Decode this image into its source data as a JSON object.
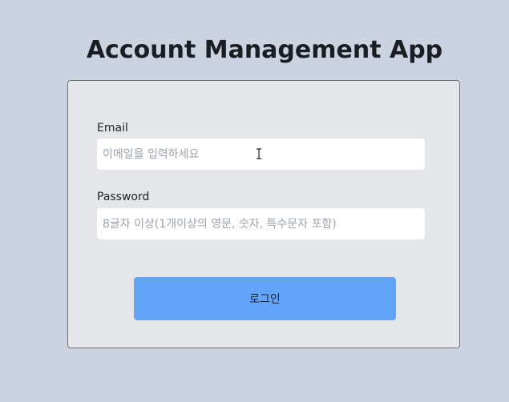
{
  "app": {
    "title": "Account Management App"
  },
  "login_form": {
    "email": {
      "label": "Email",
      "placeholder": "이메일을 입력하세요",
      "value": ""
    },
    "password": {
      "label": "Password",
      "placeholder": "8글자 이상(1개이상의 영문, 숫자, 특수문자 포함)",
      "value": ""
    },
    "submit_label": "로그인"
  },
  "cursor": {
    "icon": "text-cursor-icon"
  },
  "colors": {
    "page_background": "#cad3df",
    "card_background": "#e4e6ea",
    "button_accent": "#60a5fa",
    "placeholder_text": "#9ea3aa"
  }
}
